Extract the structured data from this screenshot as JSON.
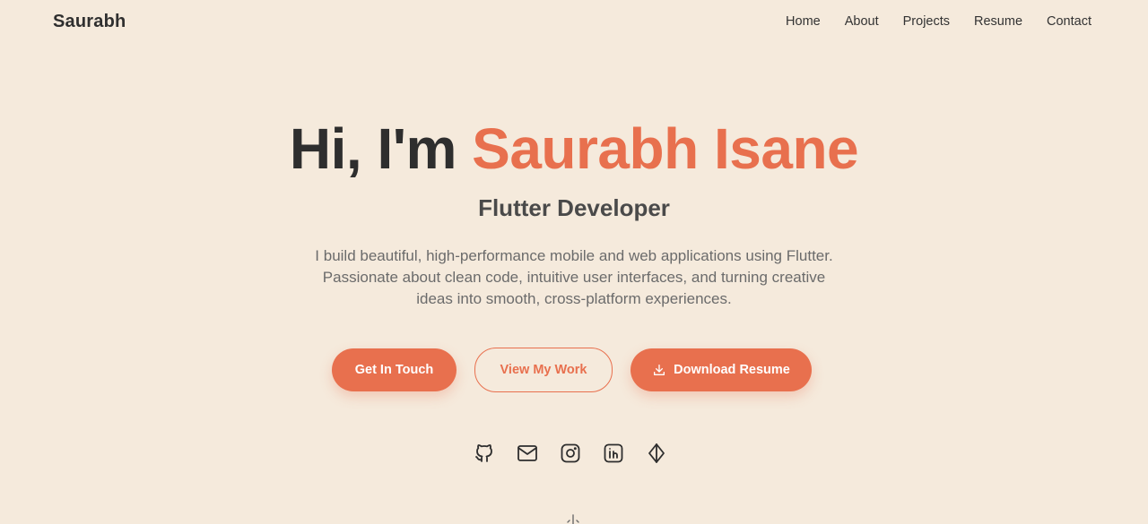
{
  "nav": {
    "brand": "Saurabh",
    "links": [
      "Home",
      "About",
      "Projects",
      "Resume",
      "Contact"
    ]
  },
  "hero": {
    "greeting": "Hi, I'm ",
    "name": "Saurabh Isane",
    "role": "Flutter Developer",
    "description": "I build beautiful, high-performance mobile and web applications using Flutter. Passionate about clean code, intuitive user interfaces, and turning creative ideas into smooth, cross-platform experiences."
  },
  "buttons": {
    "contact": "Get In Touch",
    "work": "View My Work",
    "resume": "Download Resume"
  },
  "socials": [
    "github-icon",
    "mail-icon",
    "instagram-icon",
    "linkedin-icon",
    "portfolio-icon"
  ],
  "colors": {
    "background": "#f5eadc",
    "accent": "#e8704e",
    "text": "#2e2e2e"
  }
}
